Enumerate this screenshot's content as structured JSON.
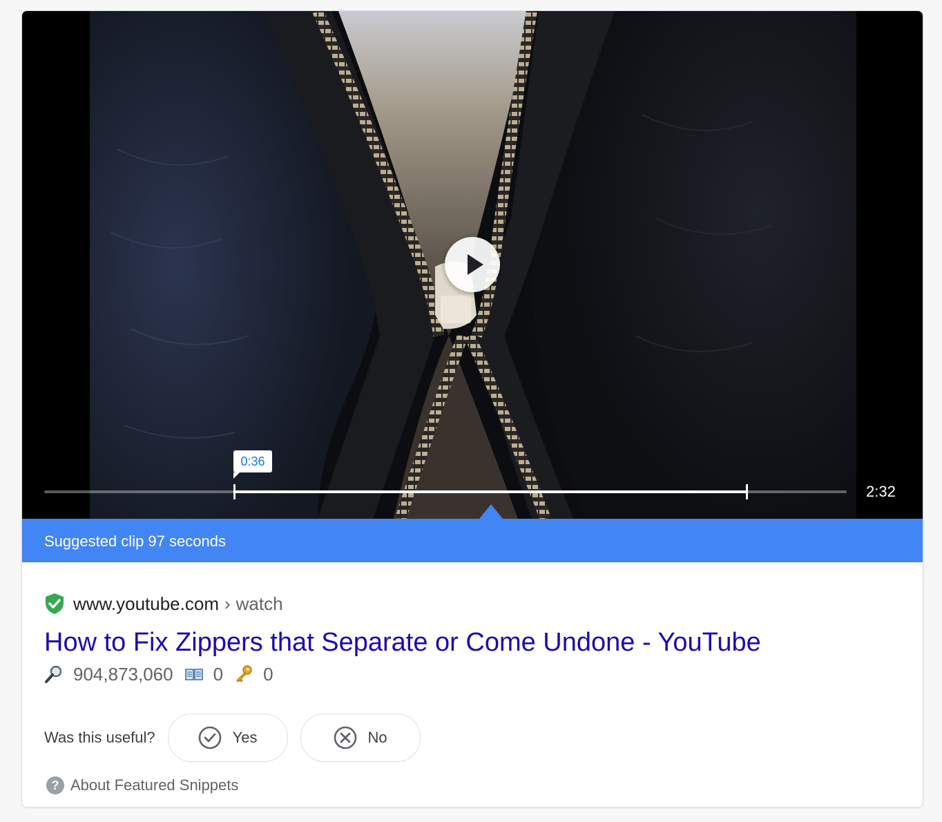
{
  "video": {
    "clip_start": "0:36",
    "duration": "2:32",
    "clip_start_seconds": 36,
    "clip_end_seconds": 133,
    "total_seconds": 152
  },
  "banner": {
    "text": "Suggested clip 97 seconds"
  },
  "result": {
    "domain": "www.youtube.com",
    "separator": "›",
    "path": "watch",
    "title": "How to Fix Zippers that Separate or Come Undone - YouTube",
    "stats": [
      {
        "icon": "magnifier-icon",
        "value": "904,873,060"
      },
      {
        "icon": "book-icon",
        "value": "0"
      },
      {
        "icon": "key-icon",
        "value": "0"
      }
    ]
  },
  "feedback": {
    "question": "Was this useful?",
    "yes_label": "Yes",
    "no_label": "No"
  },
  "about": {
    "label": "About Featured Snippets"
  },
  "colors": {
    "banner": "#4285f4",
    "title_link": "#1a0dab",
    "shield": "#34a853",
    "clip_bubble_text": "#1a73e8"
  }
}
